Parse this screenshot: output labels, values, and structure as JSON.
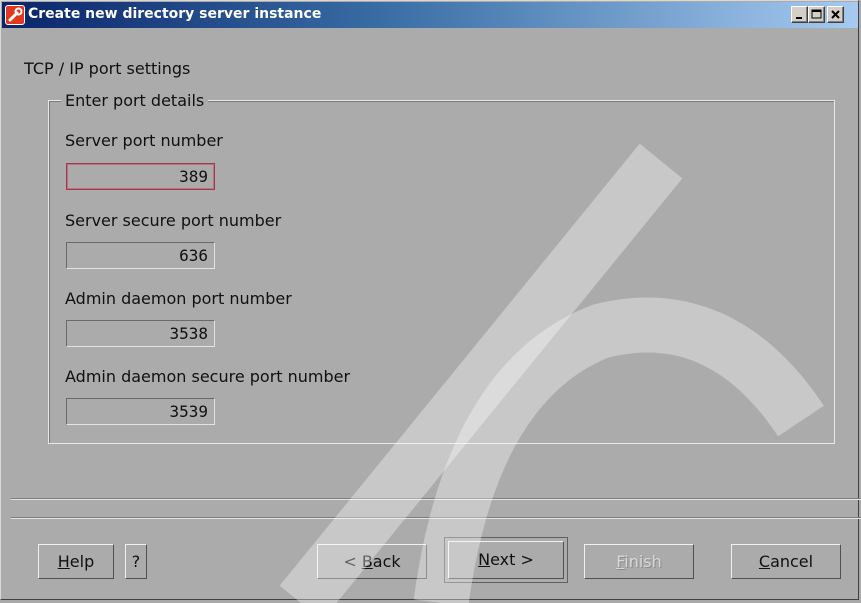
{
  "window": {
    "title": "Create new directory server instance",
    "icon": "wrench-icon",
    "controls": [
      "minimize-icon",
      "maximize-icon",
      "close-icon"
    ]
  },
  "page": {
    "section_title": "TCP / IP port settings",
    "group_title": "Enter port details"
  },
  "fields": [
    {
      "label": "Server port number",
      "value": "389"
    },
    {
      "label": "Server secure port number",
      "value": "636"
    },
    {
      "label": "Admin daemon port number",
      "value": "3538"
    },
    {
      "label": "Admin daemon secure port number",
      "value": "3539"
    }
  ],
  "buttons": {
    "help": {
      "pre": "",
      "mnemonic": "H",
      "post": "elp"
    },
    "question": "?",
    "back": {
      "pre": "< ",
      "mnemonic": "B",
      "post": "ack"
    },
    "next": {
      "pre": "",
      "mnemonic": "N",
      "post": "ext >"
    },
    "finish": {
      "pre": "",
      "mnemonic": "F",
      "post": "inish"
    },
    "cancel": {
      "pre": "",
      "mnemonic": "C",
      "post": "ancel"
    }
  },
  "colors": {
    "title_bar_start": "#0a246a",
    "title_bar_end": "#a6caf0",
    "dialog_background": "#ababab",
    "focused_field_border": "#9a3a4a"
  }
}
